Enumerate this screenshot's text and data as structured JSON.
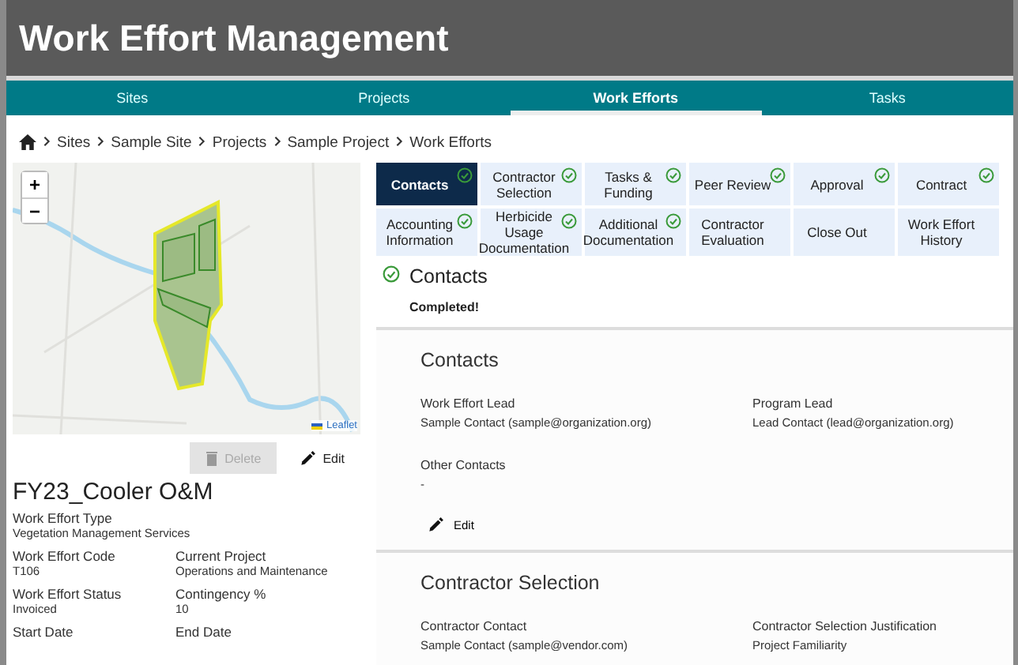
{
  "app_title": "Work Effort Management",
  "nav": [
    {
      "label": "Sites",
      "selected": false
    },
    {
      "label": "Projects",
      "selected": false
    },
    {
      "label": "Work Efforts",
      "selected": true
    },
    {
      "label": "Tasks",
      "selected": false
    }
  ],
  "breadcrumb": [
    "Sites",
    "Sample Site",
    "Projects",
    "Sample Project",
    "Work Efforts"
  ],
  "map": {
    "zoom_in": "+",
    "zoom_out": "−",
    "attribution": "Leaflet"
  },
  "actions": [
    {
      "label": "Delete",
      "kind": "delete",
      "disabled": true
    },
    {
      "label": "Edit",
      "kind": "edit",
      "disabled": false
    }
  ],
  "work_effort": {
    "name": "FY23_Cooler O&M",
    "fields": [
      {
        "label": "Work Effort Type",
        "value": "Vegetation Management Services",
        "kind": "wide"
      },
      {
        "label": "Work Effort Code",
        "value": "T106",
        "kind": "half"
      },
      {
        "label": "Current Project",
        "value": "Operations and Maintenance",
        "kind": "half"
      },
      {
        "label": "Work Effort Status",
        "value": "Invoiced",
        "kind": "half"
      },
      {
        "label": "Contingency %",
        "value": "10",
        "kind": "half"
      },
      {
        "label": "Start Date",
        "kind": "half"
      },
      {
        "label": "End Date",
        "kind": "half"
      }
    ]
  },
  "steps": [
    {
      "label": "Contacts",
      "selected": true,
      "completed": true
    },
    {
      "label": "Contractor Selection",
      "selected": false,
      "completed": true
    },
    {
      "label": "Tasks & Funding",
      "selected": false,
      "completed": true
    },
    {
      "label": "Peer Review",
      "selected": false,
      "completed": true
    },
    {
      "label": "Approval",
      "selected": false,
      "completed": true
    },
    {
      "label": "Contract",
      "selected": false,
      "completed": true
    },
    {
      "label": "Accounting Information",
      "selected": false,
      "completed": true
    },
    {
      "label": "Herbicide Usage Documentation",
      "selected": false,
      "completed": true
    },
    {
      "label": "Additional Documentation",
      "selected": false,
      "completed": true
    },
    {
      "label": "Contractor Evaluation",
      "selected": false,
      "completed": false
    },
    {
      "label": "Close Out",
      "selected": false,
      "completed": false
    },
    {
      "label": "Work Effort History",
      "selected": false,
      "completed": false
    }
  ],
  "status": {
    "title": "Contacts",
    "message": "Completed!",
    "completed": true
  },
  "sections": [
    {
      "title": "Contacts",
      "fields": [
        {
          "label": "Work Effort Lead",
          "value": "Sample Contact (sample@organization.org)"
        },
        {
          "label": "Program Lead",
          "value": "Lead Contact (lead@organization.org)"
        },
        {
          "label": "Other Contacts",
          "value": "-"
        }
      ],
      "edit": "Edit"
    },
    {
      "title": "Contractor Selection",
      "fields": [
        {
          "label": "Contractor Contact",
          "value": "Sample Contact (sample@vendor.com)"
        },
        {
          "label": "Contractor Selection Justification",
          "value": "Project Familiarity"
        }
      ]
    }
  ]
}
